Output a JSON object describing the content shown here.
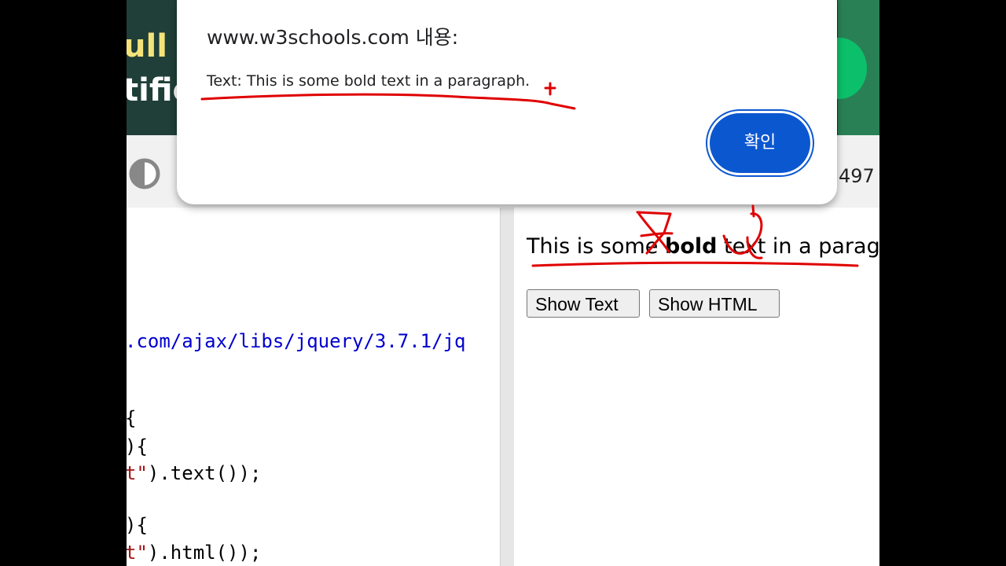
{
  "banner": {
    "line1": "ull A",
    "line2": "tific"
  },
  "toolbar": {
    "count": "497"
  },
  "code": {
    "url_line": ".com/ajax/libs/jquery/3.7.1/jq",
    "brace_line": "{",
    "fn_line1": "){",
    "text_line_str": "t\"",
    "text_line_rest": ").text());",
    "fn_line2": "){",
    "html_line_str": "t\"",
    "html_line_rest": ").html());"
  },
  "result": {
    "para_before": "This is some ",
    "para_bold": "bold",
    "para_after": " text in a paragraph.",
    "show_text_button": "Show Text",
    "show_html_button": "Show HTML"
  },
  "dialog": {
    "title": "www.w3schools.com 내용:",
    "message": "Text: This is some bold text in a paragraph.",
    "ok_button": "확인"
  },
  "annotation": {
    "color": "#e00000"
  }
}
